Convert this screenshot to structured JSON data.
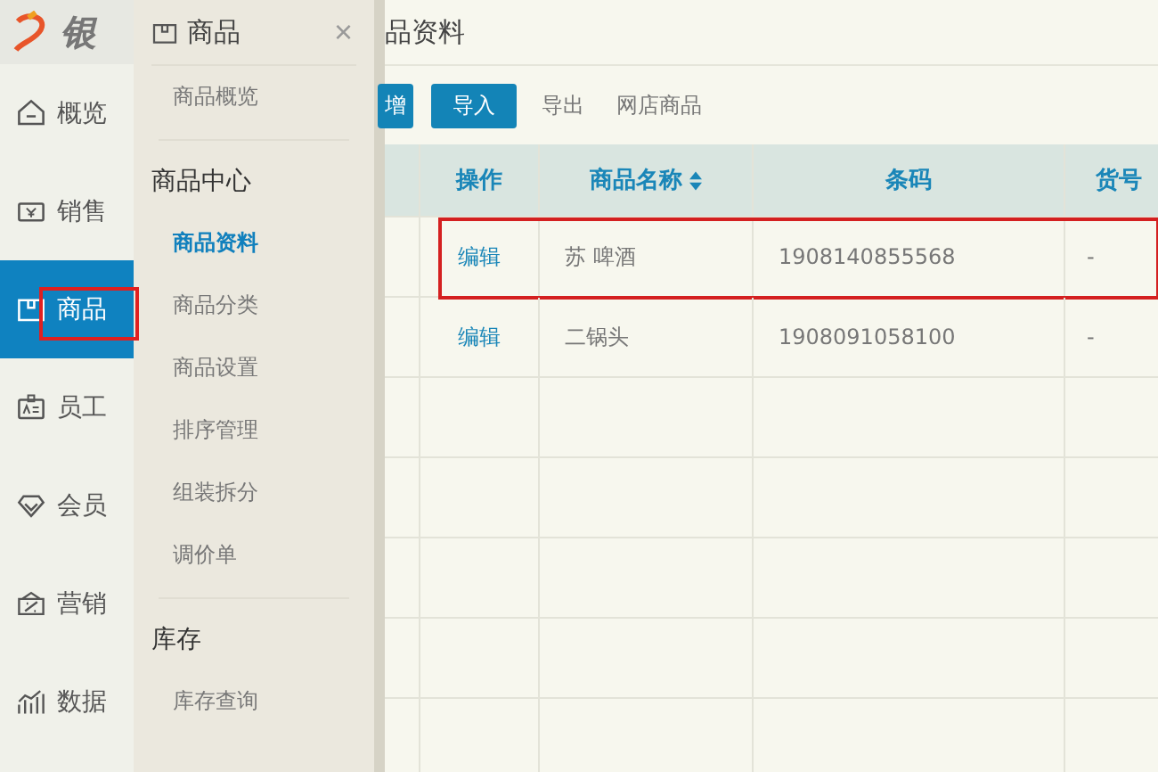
{
  "logo": {
    "text": "银"
  },
  "nav": [
    {
      "label": "概览",
      "selected": false,
      "highlighted": false
    },
    {
      "label": "销售",
      "selected": false,
      "highlighted": false
    },
    {
      "label": "商品",
      "selected": true,
      "highlighted": true
    },
    {
      "label": "员工",
      "selected": false,
      "highlighted": false
    },
    {
      "label": "会员",
      "selected": false,
      "highlighted": false
    },
    {
      "label": "营销",
      "selected": false,
      "highlighted": false
    },
    {
      "label": "数据",
      "selected": false,
      "highlighted": false
    }
  ],
  "flyout": {
    "title": "商品",
    "close": "×",
    "items": [
      {
        "kind": "link",
        "label": "商品概览",
        "selected": false
      },
      {
        "kind": "divider"
      },
      {
        "kind": "heading",
        "label": "商品中心"
      },
      {
        "kind": "link",
        "label": "商品资料",
        "selected": true
      },
      {
        "kind": "link",
        "label": "商品分类",
        "selected": false
      },
      {
        "kind": "link",
        "label": "商品设置",
        "selected": false
      },
      {
        "kind": "link",
        "label": "排序管理",
        "selected": false
      },
      {
        "kind": "link",
        "label": "组装拆分",
        "selected": false
      },
      {
        "kind": "link",
        "label": "调价单",
        "selected": false
      },
      {
        "kind": "divider"
      },
      {
        "kind": "heading",
        "label": "库存"
      },
      {
        "kind": "link",
        "label": "库存查询",
        "selected": false
      }
    ]
  },
  "main": {
    "title": "品资料",
    "toolbar": [
      {
        "label": "增",
        "kind": "primary"
      },
      {
        "label": "导入",
        "kind": "primary"
      },
      {
        "label": "导出",
        "kind": "link"
      },
      {
        "label": "网店商品",
        "kind": "link"
      }
    ],
    "table": {
      "columns": [
        {
          "label": "操作",
          "sortable": false
        },
        {
          "label": "商品名称",
          "sortable": true
        },
        {
          "label": "条码",
          "sortable": false
        },
        {
          "label": "货号",
          "sortable": false
        }
      ],
      "rows": [
        {
          "action": "编辑",
          "name": "苏 啤酒",
          "barcode": "1908140855568",
          "item_no": "-",
          "highlighted": true
        },
        {
          "action": "编辑",
          "name": "二锅头",
          "barcode": "1908091058100",
          "item_no": "-",
          "highlighted": false
        }
      ]
    }
  }
}
